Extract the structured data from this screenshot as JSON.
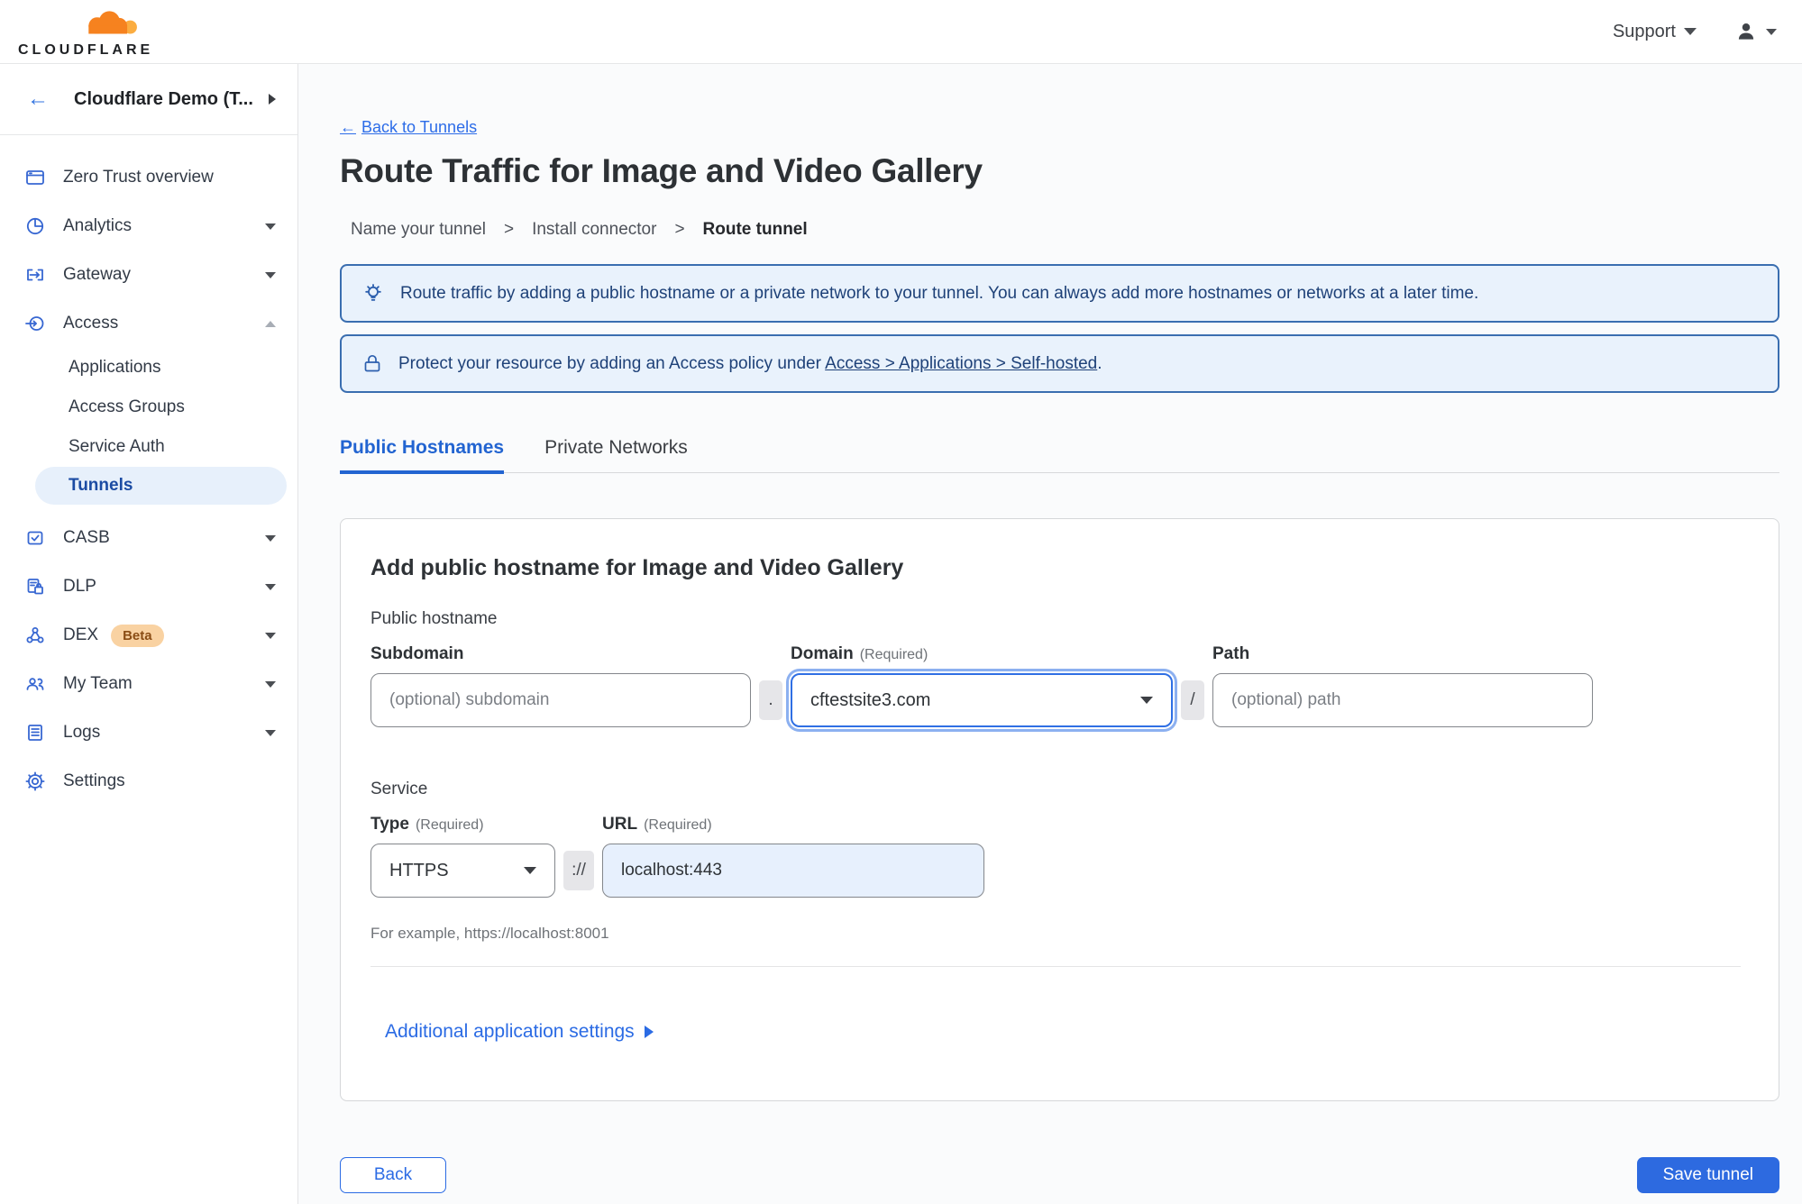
{
  "colors": {
    "accent_blue": "#2b6be4",
    "active_tab_blue": "#2264d1",
    "save_button_bg": "#2d6ae0",
    "banner_bg": "#e9f2fc",
    "banner_border": "#3a6eb0",
    "banner_text": "#1e4178",
    "active_item_bg": "#e7f0fb",
    "active_item_text": "#1b4ba3",
    "beta_badge_bg": "#f9d2a2",
    "beta_badge_text": "#8a4d15",
    "url_input_bg": "#e7f0fd",
    "brand_orange": "#f6821f",
    "brand_orange_light": "#fbad41"
  },
  "topbar": {
    "brand": "CLOUDFLARE",
    "support_label": "Support"
  },
  "sidebar": {
    "account_label": "Cloudflare Demo (T...",
    "items": [
      {
        "label": "Zero Trust overview"
      },
      {
        "label": "Analytics"
      },
      {
        "label": "Gateway"
      },
      {
        "label": "Access"
      },
      {
        "label": "CASB"
      },
      {
        "label": "DLP"
      },
      {
        "label": "DEX",
        "badge": "Beta"
      },
      {
        "label": "My Team"
      },
      {
        "label": "Logs"
      },
      {
        "label": "Settings"
      }
    ],
    "access_children": [
      {
        "label": "Applications"
      },
      {
        "label": "Access Groups"
      },
      {
        "label": "Service Auth"
      },
      {
        "label": "Tunnels"
      }
    ]
  },
  "main": {
    "back_link": {
      "arrow": "←",
      "label": "Back to Tunnels"
    },
    "title": "Route Traffic for Image and Video Gallery",
    "steps": {
      "items": [
        "Name your tunnel",
        "Install connector",
        "Route tunnel"
      ],
      "separator": ">"
    },
    "banners": {
      "tip": {
        "icon": "lightbulb-icon",
        "text": "Route traffic by adding a public hostname or a private network to your tunnel. You can always add more hostnames or networks at a later time."
      },
      "protect": {
        "icon": "lock-icon",
        "text_before": "Protect your resource by adding an Access policy under",
        "link": "Access > Applications > Self-hosted",
        "text_after": "."
      }
    },
    "tabs": [
      {
        "label": "Public Hostnames",
        "active": true
      },
      {
        "label": "Private Networks",
        "active": false
      }
    ],
    "card": {
      "heading": "Add public hostname for Image and Video Gallery",
      "hostname_section_label": "Public hostname",
      "subdomain": {
        "label": "Subdomain",
        "placeholder": "(optional) subdomain"
      },
      "dot_separator": ".",
      "domain": {
        "label": "Domain",
        "required_hint": "(Required)",
        "value": "cftestsite3.com"
      },
      "slash_separator": "/",
      "path": {
        "label": "Path",
        "placeholder": "(optional) path"
      },
      "service_section_label": "Service",
      "type": {
        "label": "Type",
        "required_hint": "(Required)",
        "value": "HTTPS"
      },
      "scheme_separator": "://",
      "url": {
        "label": "URL",
        "required_hint": "(Required)",
        "value": "localhost:443"
      },
      "example_text": "For example, https://localhost:8001",
      "additional_settings_label": "Additional application settings"
    },
    "footer": {
      "back_label": "Back",
      "save_label": "Save tunnel"
    }
  }
}
